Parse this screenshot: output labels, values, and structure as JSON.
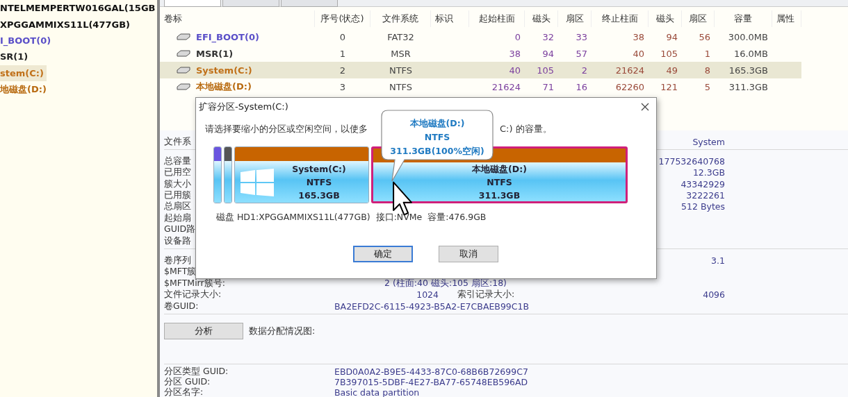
{
  "sidebar": {
    "items": [
      {
        "label": "NTELMEMPERTW016GAL(15GB",
        "selected": false,
        "color": "#111111"
      },
      {
        "label": "XPGGAMMIXS11L(477GB)",
        "selected": false,
        "color": "#111111",
        "children": [
          {
            "label": "I_BOOT(0)",
            "selected": false,
            "color": "#5a4fc8"
          },
          {
            "label": "SR(1)",
            "selected": false,
            "color": "#222222"
          },
          {
            "label": "stem(C:)",
            "selected": true,
            "color": "#c07018"
          },
          {
            "label": "地磁盘(D:)",
            "selected": false,
            "color": "#b86a10"
          }
        ]
      }
    ]
  },
  "tabs": [
    {
      "selected": true
    },
    {
      "selected": false
    },
    {
      "selected": false
    }
  ],
  "table": {
    "columns": [
      "卷标",
      "序号(状态)",
      "文件系统",
      "标识",
      "起始柱面",
      "磁头",
      "扇区",
      "终止柱面",
      "磁头",
      "扇区",
      "容量",
      "属性"
    ],
    "rows": [
      {
        "cells": [
          "EFI_BOOT(0)",
          "0",
          "FAT32",
          "",
          "0",
          "32",
          "33",
          "38",
          "94",
          "56",
          "300.0MB",
          ""
        ],
        "color": "#5a4fc8",
        "selected": false
      },
      {
        "cells": [
          "MSR(1)",
          "1",
          "MSR",
          "",
          "38",
          "94",
          "57",
          "40",
          "105",
          "1",
          "16.0MB",
          ""
        ],
        "color": "#333333",
        "selected": false
      },
      {
        "cells": [
          "System(C:)",
          "2",
          "NTFS",
          "",
          "40",
          "105",
          "2",
          "21624",
          "49",
          "8",
          "165.3GB",
          ""
        ],
        "color": "#c07018",
        "selected": true
      },
      {
        "cells": [
          "本地磁盘(D:)",
          "3",
          "NTFS",
          "",
          "21624",
          "71",
          "16",
          "62260",
          "121",
          "5",
          "311.3GB",
          ""
        ],
        "color": "#b86a10",
        "selected": false
      }
    ]
  },
  "details": {
    "groups": [
      {
        "rows": [
          {
            "kind": "stat",
            "label": "文件系",
            "value_2": "System"
          }
        ]
      },
      {
        "rows": [
          {
            "kind": "stat",
            "label": "总容量",
            "value_2": "177532640768"
          },
          {
            "kind": "stat",
            "label": "已用空",
            "value_2": "12.3GB"
          },
          {
            "kind": "stat",
            "label": "簇大小",
            "value_2": "43342929"
          },
          {
            "kind": "stat",
            "label": "已用簇",
            "value_2": "3222261"
          },
          {
            "kind": "stat",
            "label": "总扇区",
            "value_2": "512 Bytes"
          },
          {
            "kind": "stat",
            "label": "起始扇"
          },
          {
            "kind": "stat",
            "label": "GUID路"
          },
          {
            "kind": "stat",
            "label": "设备路"
          }
        ]
      },
      {
        "rows": [
          {
            "kind": "stat",
            "label": "卷序列",
            "value_2": "3.1"
          },
          {
            "kind": "stat",
            "label": "$MFT簇"
          },
          {
            "kind": "stat",
            "label": "$MFTMirr簇号:",
            "value": "2 (柱面:40 磁头:105 扇区:18)"
          },
          {
            "kind": "pair",
            "label": "文件记录大小:",
            "value": "1024",
            "label_2": "索引记录大小:",
            "value_2": "4096"
          },
          {
            "kind": "guid",
            "label": "卷GUID:",
            "value": "BA2EFD2C-6115-4923-B5A2-E7CBAEB99C1B"
          }
        ]
      }
    ],
    "analyze": {
      "button": "分析",
      "label": "数据分配情况图:"
    },
    "partition": [
      {
        "kind": "guid",
        "label": "分区类型 GUID:",
        "value": "EBD0A0A2-B9E5-4433-87C0-68B6B72699C7"
      },
      {
        "kind": "guid",
        "label": "分区 GUID:",
        "value": "7B397015-5DBF-4E27-BA77-65748EB596AD"
      },
      {
        "kind": "guid",
        "label": "分区名字:",
        "value": "Basic data partition"
      }
    ]
  },
  "dialog": {
    "title": "扩容分区-System(C:)",
    "instruction": [
      "请选择要缩小的分区或空闲空间，以使多",
      "C:) 的容量。"
    ],
    "tooltip": [
      "本地磁盘(D:)",
      "NTFS",
      "311.3GB(100%空闲)"
    ],
    "disk_map": [
      {
        "kind": "small",
        "color": "#6a55e0",
        "selected": false
      },
      {
        "kind": "small",
        "color": "#555555",
        "selected": false
      },
      {
        "kind": "os",
        "color": "#c86400",
        "selected": false,
        "label": "System(C:)",
        "fs": "NTFS",
        "size": "165.3GB"
      },
      {
        "kind": "data",
        "color": "#c86400",
        "selected": true,
        "label": "本地磁盘(D:)",
        "fs": "NTFS",
        "size": "311.3GB"
      }
    ],
    "disk_info": "磁盘 HD1:XPGGAMMIXS11L(477GB)  接口:NVMe  容量:476.9GB",
    "buttons": [
      {
        "label": "确定",
        "focused": true
      },
      {
        "label": "取消",
        "focused": false
      }
    ]
  }
}
